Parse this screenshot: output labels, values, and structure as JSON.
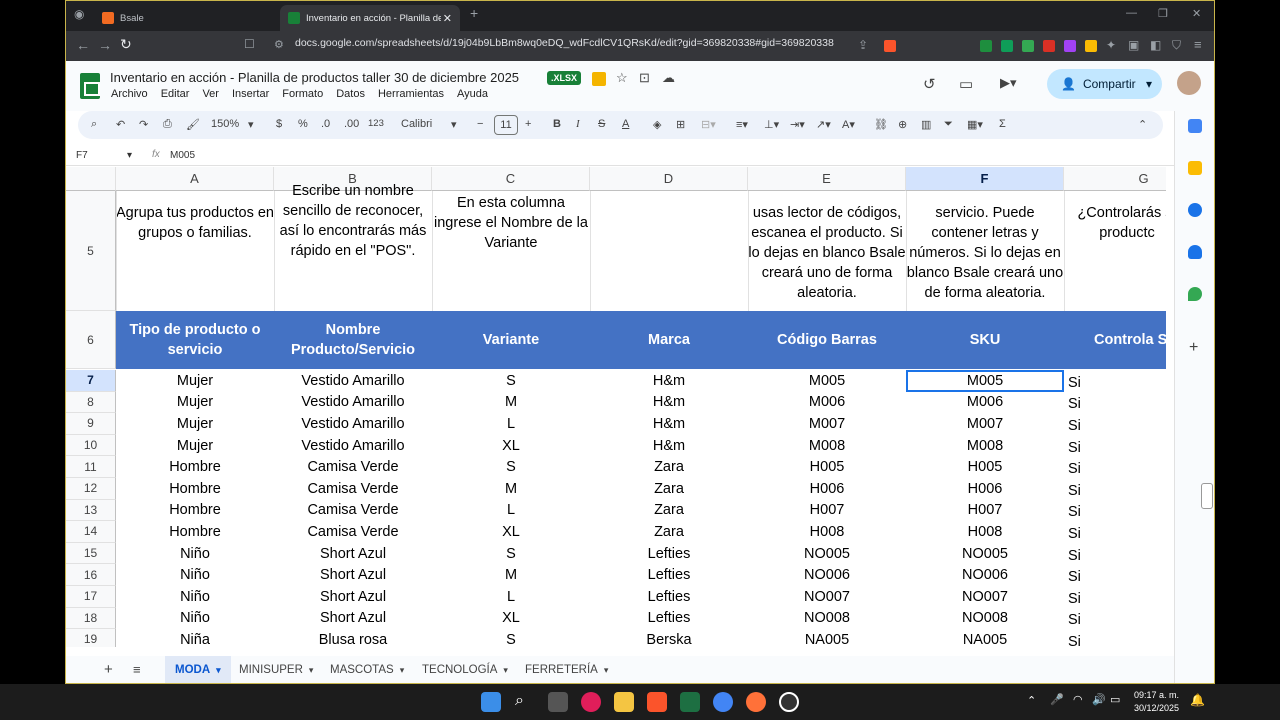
{
  "browser": {
    "tabs": [
      {
        "title": "Bsale",
        "active": false
      },
      {
        "title": "Inventario en acción - Planilla de",
        "active": true
      }
    ],
    "url": "docs.google.com/spreadsheets/d/19j04b9LbBm8wq0eDQ_wdFcdlCV1QRsKd/edit?gid=369820338#gid=369820338"
  },
  "doc": {
    "title": "Inventario en acción - Planilla de productos taller 30 de diciembre 2025",
    "badge": ".XLSX",
    "menu": [
      "Archivo",
      "Editar",
      "Ver",
      "Insertar",
      "Formato",
      "Datos",
      "Herramientas",
      "Ayuda"
    ],
    "share_label": "Compartir"
  },
  "toolbar": {
    "zoom": "150%",
    "currency": "$",
    "percent": "%",
    "dec_minus": ".0",
    "dec_plus": ".00",
    "number_format": "123",
    "font": "Calibri",
    "font_size": "11",
    "bold": "B",
    "italic": "I",
    "sigma": "Σ"
  },
  "formula_bar": {
    "cell_ref": "F7",
    "fx": "fx",
    "value": "M005"
  },
  "columns": [
    "A",
    "B",
    "C",
    "D",
    "E",
    "F",
    "G"
  ],
  "selected_column": "F",
  "row5": {
    "number": "5",
    "A": "Agrupa tus productos en grupos o familias.",
    "B": "Escribe un nombre sencillo de reconocer, así lo encontrarás más rápido en el \"POS\".",
    "C": "En esta columna ingrese el Nombre de la Variante",
    "D": "",
    "E": "usas lector de códigos, escanea el producto. Si lo dejas en blanco Bsale creará uno de forma aleatoria.",
    "F": "servicio. Puede contener letras y números. Si lo dejas en blanco Bsale creará uno de forma aleatoria.",
    "G": "¿Controlarás st productc"
  },
  "header_row": {
    "number": "6",
    "cells": [
      "Tipo de producto o servicio",
      "Nombre Producto/Servicio",
      "Variante",
      "Marca",
      "Código Barras",
      "SKU",
      "Controla St"
    ]
  },
  "rows": [
    {
      "n": "7",
      "c": [
        "Mujer",
        "Vestido Amarillo",
        "S",
        "H&m",
        "M005",
        "M005",
        "Si"
      ]
    },
    {
      "n": "8",
      "c": [
        "Mujer",
        "Vestido Amarillo",
        "M",
        "H&m",
        "M006",
        "M006",
        "Si"
      ]
    },
    {
      "n": "9",
      "c": [
        "Mujer",
        "Vestido Amarillo",
        "L",
        "H&m",
        "M007",
        "M007",
        "Si"
      ]
    },
    {
      "n": "10",
      "c": [
        "Mujer",
        "Vestido Amarillo",
        "XL",
        "H&m",
        "M008",
        "M008",
        "Si"
      ]
    },
    {
      "n": "11",
      "c": [
        "Hombre",
        "Camisa Verde",
        "S",
        "Zara",
        "H005",
        "H005",
        "Si"
      ]
    },
    {
      "n": "12",
      "c": [
        "Hombre",
        "Camisa Verde",
        "M",
        "Zara",
        "H006",
        "H006",
        "Si"
      ]
    },
    {
      "n": "13",
      "c": [
        "Hombre",
        "Camisa Verde",
        "L",
        "Zara",
        "H007",
        "H007",
        "Si"
      ]
    },
    {
      "n": "14",
      "c": [
        "Hombre",
        "Camisa Verde",
        "XL",
        "Zara",
        "H008",
        "H008",
        "Si"
      ]
    },
    {
      "n": "15",
      "c": [
        "Niño",
        "Short Azul",
        "S",
        "Lefties",
        "NO005",
        "NO005",
        "Si"
      ]
    },
    {
      "n": "16",
      "c": [
        "Niño",
        "Short Azul",
        "M",
        "Lefties",
        "NO006",
        "NO006",
        "Si"
      ]
    },
    {
      "n": "17",
      "c": [
        "Niño",
        "Short Azul",
        "L",
        "Lefties",
        "NO007",
        "NO007",
        "Si"
      ]
    },
    {
      "n": "18",
      "c": [
        "Niño",
        "Short Azul",
        "XL",
        "Lefties",
        "NO008",
        "NO008",
        "Si"
      ]
    },
    {
      "n": "19",
      "c": [
        "Niña",
        "Blusa rosa",
        "S",
        "Berska",
        "NA005",
        "NA005",
        "Si"
      ]
    }
  ],
  "sheet_tabs": [
    {
      "label": "MODA",
      "active": true
    },
    {
      "label": "MINISUPER",
      "active": false
    },
    {
      "label": "MASCOTAS",
      "active": false
    },
    {
      "label": "TECNOLOGÍA",
      "active": false
    },
    {
      "label": "FERRETERÍA",
      "active": false
    }
  ],
  "taskbar": {
    "time": "09:17 a. m.",
    "date": "30/12/2025"
  },
  "colors": {
    "header_fill": "#4472c4",
    "selection": "#1a73e8",
    "sheets_green": "#188038"
  }
}
